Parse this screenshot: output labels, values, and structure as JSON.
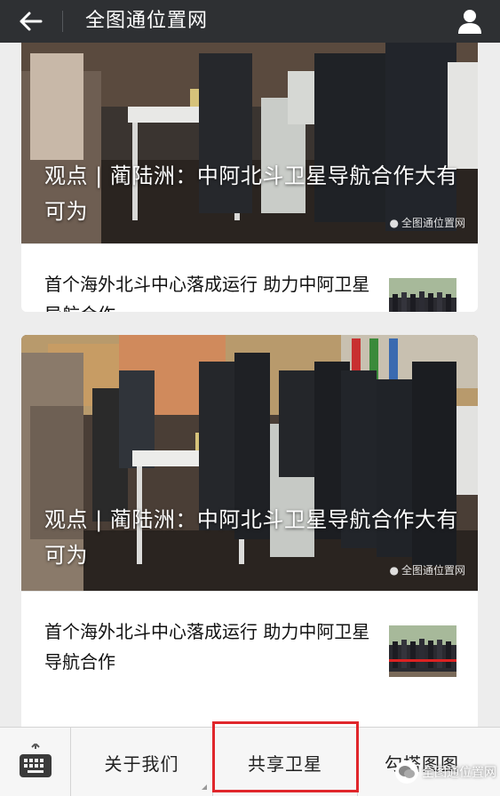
{
  "header": {
    "title": "全图通位置网",
    "back_icon": "arrow-left-icon",
    "profile_icon": "person-icon"
  },
  "feed": {
    "cards": [
      {
        "hero_title": "观点 | 蔺陆洲：中阿北斗卫星导航合作大有可为",
        "watermark": "全图通位置网",
        "sub_title": "首个海外北斗中心落成运行 助力中阿卫星导航合作"
      },
      {
        "hero_title": "观点 | 蔺陆洲：中阿北斗卫星导航合作大有可为",
        "watermark": "全图通位置网",
        "sub_title": "首个海外北斗中心落成运行 助力中阿卫星导航合作"
      }
    ]
  },
  "menu": {
    "keyboard_icon": "keyboard-icon",
    "items": [
      {
        "label": "关于我们"
      },
      {
        "label": "共享卫星"
      },
      {
        "label": "勾搭图图"
      }
    ],
    "bottom_watermark": "全图通位置网"
  },
  "colors": {
    "header_bg": "#2e3033",
    "highlight": "#e0262b"
  }
}
